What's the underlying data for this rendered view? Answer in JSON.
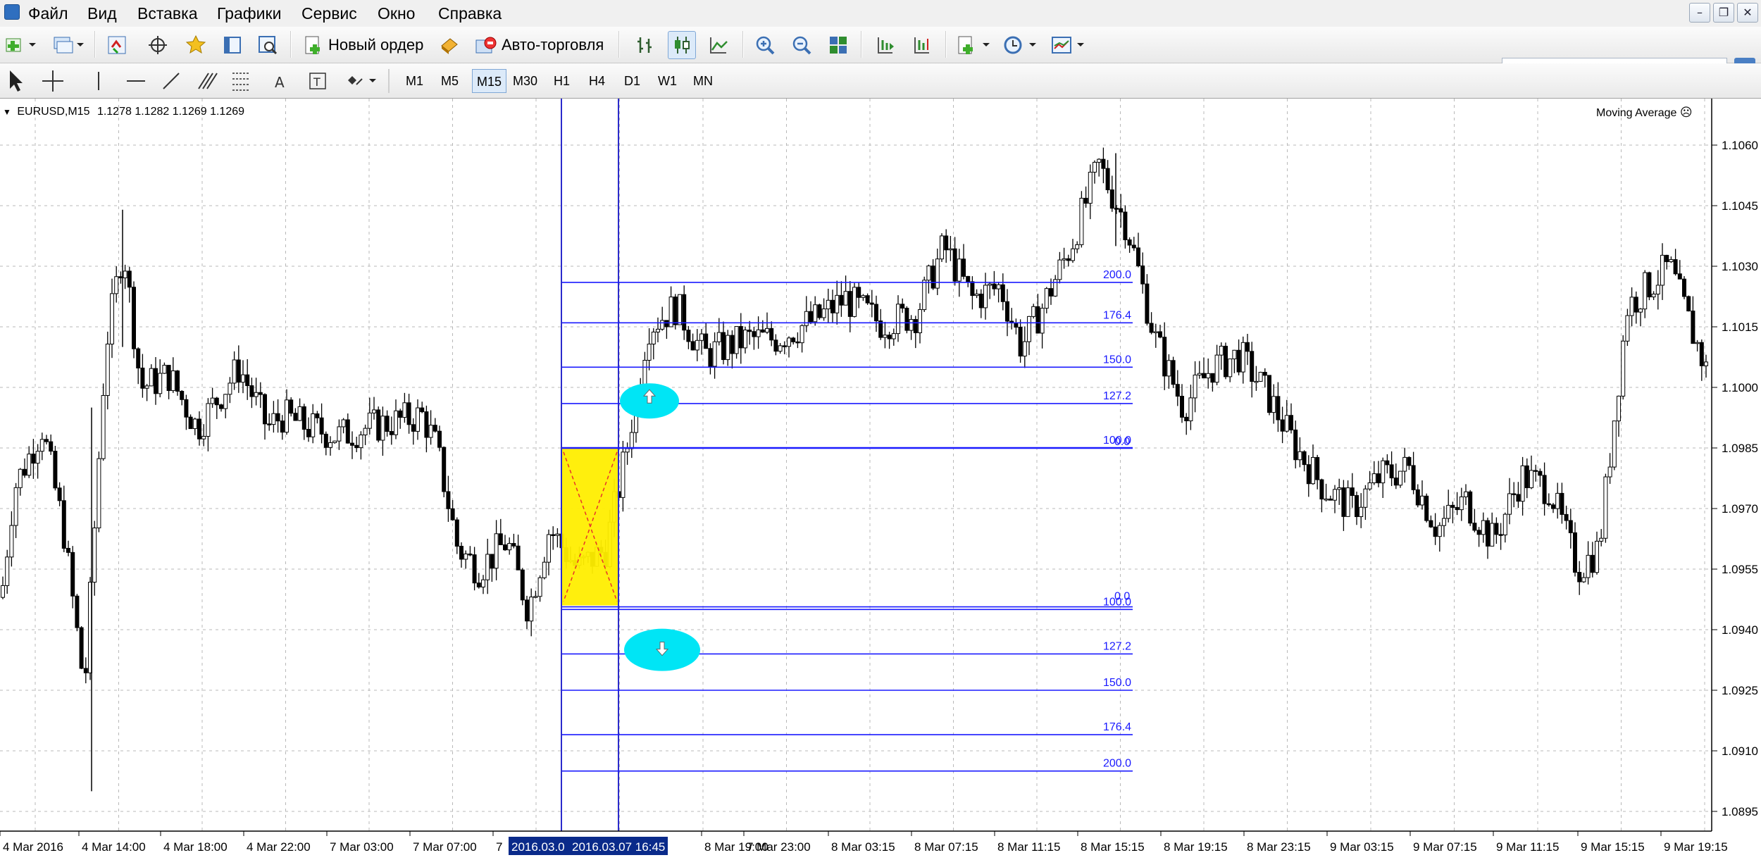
{
  "menu": {
    "items": [
      "Файл",
      "Вид",
      "Вставка",
      "Графики",
      "Сервис",
      "Окно",
      "Справка"
    ]
  },
  "toolbar": {
    "new_order_label": "Новый ордер",
    "autotrading_label": "Авто-торговля",
    "search_placeholder": ""
  },
  "timeframes": [
    "M1",
    "M5",
    "M15",
    "M30",
    "H1",
    "H4",
    "D1",
    "W1",
    "MN"
  ],
  "active_timeframe": "M15",
  "chart": {
    "symbol_label": "EURUSD,M15",
    "ohlc_label": "1.1278 1.1282 1.1269 1.1269",
    "indicator_label": "Moving Average",
    "price_axis": [
      "1.1060",
      "1.1045",
      "1.1030",
      "1.1015",
      "1.1000",
      "1.0985",
      "1.0970",
      "1.0955",
      "1.0940",
      "1.0925",
      "1.0910",
      "1.0895"
    ],
    "time_axis": [
      "4 Mar 2016",
      "4 Mar 14:00",
      "4 Mar 18:00",
      "4 Mar 22:00",
      "7 Mar 03:00",
      "7 Mar 07:00",
      "7",
      "8 Mar 19:00",
      "7 Mar 23:00",
      "8 Mar 03:15",
      "8 Mar 07:15",
      "8 Mar 11:15",
      "8 Mar 15:15",
      "8 Mar 19:15",
      "8 Mar 23:15",
      "9 Mar 03:15",
      "9 Mar 07:15",
      "9 Mar 11:15",
      "9 Mar 15:15",
      "9 Mar 19:15"
    ],
    "highlight_time_labels": [
      "2016.03.0",
      "2016.03.07 16:45"
    ],
    "upper_fib_levels": [
      "200.0",
      "176.4",
      "150.0",
      "127.2",
      "100.0"
    ],
    "lower_fib_levels": [
      "0.0",
      "100.0",
      "127.2",
      "150.0",
      "176.4",
      "200.0"
    ],
    "fib_overlap_label": "0.0",
    "colors": {
      "fib": "#1a1aff",
      "vline": "#2b2bcc",
      "box_fill": "#ffee00",
      "box_cross": "#e8342a",
      "ellipse": "#00e5f5",
      "grid": "#b8b8b8",
      "candle_up": "#ffffff",
      "candle_down": "#000000"
    }
  }
}
